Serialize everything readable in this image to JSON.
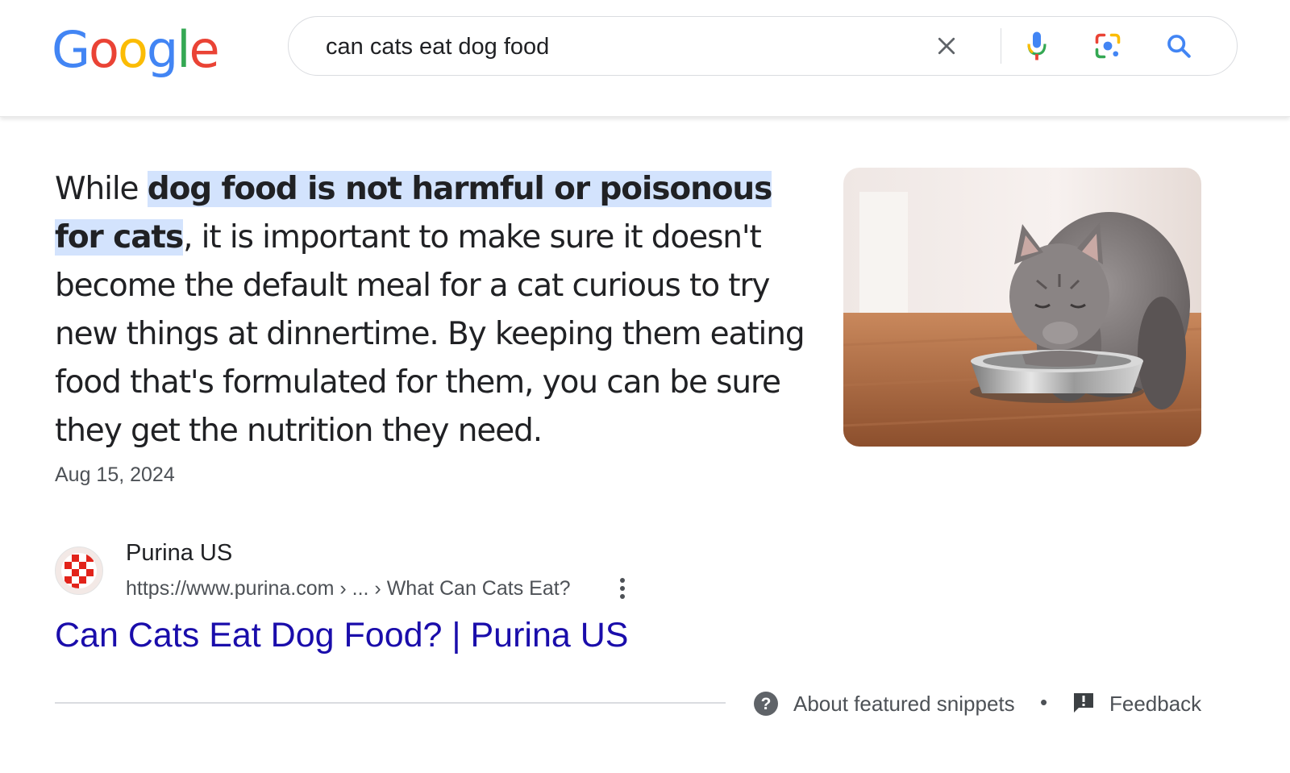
{
  "header": {
    "logo_letters": [
      {
        "char": "G",
        "color": "#4285f4"
      },
      {
        "char": "o",
        "color": "#ea4335"
      },
      {
        "char": "o",
        "color": "#fbbc05"
      },
      {
        "char": "g",
        "color": "#4285f4"
      },
      {
        "char": "l",
        "color": "#34a853"
      },
      {
        "char": "e",
        "color": "#ea4335"
      }
    ],
    "search": {
      "value": "can cats eat dog food",
      "icons": [
        "clear-icon",
        "mic-icon",
        "lens-icon",
        "search-icon"
      ]
    }
  },
  "snippet": {
    "text_before": "While ",
    "highlight": "dog food is not harmful or poisonous for cats",
    "text_after": ", it is important to make sure it doesn't become the default meal for a cat curious to try new things at dinnertime. By keeping them eating food that's formulated for them, you can be sure they get the nutrition they need.",
    "date": "Aug 15, 2024",
    "highlight_color": "#d3e3fd",
    "image": "cat-eating-from-bowl"
  },
  "source": {
    "site_name": "Purina US",
    "url": "https://www.purina.com › ... › What Can Cats Eat?",
    "title": "Can Cats Eat Dog Food? | Purina US",
    "title_color": "#1a0dab",
    "favicon": "purina-checkerboard-icon"
  },
  "footer": {
    "about_label": "About featured snippets",
    "separator": "•",
    "feedback_label": "Feedback"
  }
}
